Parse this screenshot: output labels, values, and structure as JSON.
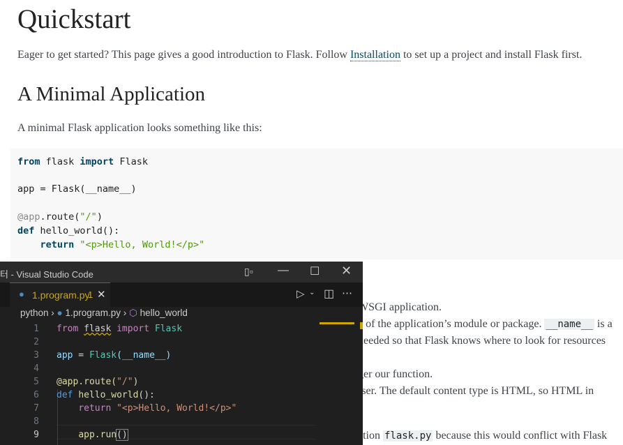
{
  "doc": {
    "title": "Quickstart",
    "intro_before": "Eager to get started? This page gives a good introduction to Flask. Follow ",
    "intro_link": "Installation",
    "intro_after": " to set up a project and install Flask first.",
    "h2": "A Minimal Application",
    "minimal_text": "A minimal Flask application looks something like this:",
    "code": {
      "l1a": "from",
      "l1b": " flask ",
      "l1c": "import",
      "l1d": " Flask",
      "l2": "app = Flask(__name__)",
      "l3a": "@app",
      "l3b": ".route(",
      "l3c": "\"/\"",
      "l3d": ")",
      "l4a": "def",
      "l4b": " hello_world():",
      "l5a": "    return",
      "l5b": " \"<p>Hello, World!</p>\""
    },
    "partial": {
      "r1": "WSGI application.",
      "r2a": "e of the application’s module or package. ",
      "r2code": "__name__",
      "r2b": " is a",
      "r3": "needed so that Flask knows where to look for resources",
      "r4": "ger our function.",
      "r5": "rser. The default content type is HTML, so HTML in",
      "r6a": "ation ",
      "r6code": "flask.py",
      "r6b": " because this would conflict with Flask"
    }
  },
  "vscode": {
    "title": "터 - Visual Studio Code",
    "tab_label": "1.program.py",
    "tab_problems": "1",
    "breadcrumb": [
      "python",
      "1.program.py",
      "hello_world"
    ],
    "line_numbers": [
      "1",
      "2",
      "3",
      "4",
      "5",
      "6",
      "7",
      "8",
      "9"
    ],
    "code": {
      "l1a": "from",
      "l1b": "flask",
      "l1c": "import",
      "l1d": "Flask",
      "l3a": "app",
      "l3b": " = ",
      "l3c": "Flask",
      "l3d": "(__name__)",
      "l5a": "@app.route(",
      "l5b": "\"/\"",
      "l5c": ")",
      "l6a": "def",
      "l6b": "hello_world",
      "l6c": "():",
      "l7a": "return",
      "l7b": "\"<p>Hello, World!</p>\"",
      "l9a": "app.run",
      "l9b": "()"
    }
  }
}
